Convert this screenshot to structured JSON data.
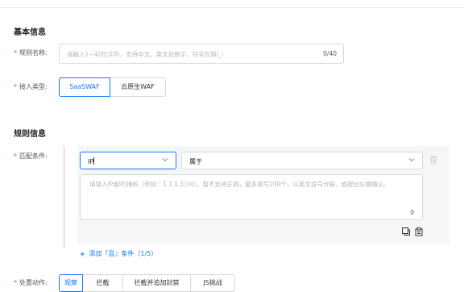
{
  "basic_info": {
    "title": "基本信息",
    "rule_name": {
      "label": "规则名称:",
      "placeholder": "请输入1~40位字符，支持中文、英文及数字，符号仅限/_-",
      "counter": "0/40"
    },
    "access_type": {
      "label": "接入类型:",
      "options": [
        "SaaSWAF",
        "云原生WAF"
      ],
      "selected": "SaaSWAF"
    }
  },
  "rule_info": {
    "title": "规则信息",
    "match_condition": {
      "label": "匹配条件:",
      "field_select": "IP",
      "operator_select": "属于",
      "textarea_placeholder": "请填入IP或IP/掩码（例如：1.1.1.1/24），暂不支持正则，最多填写200个，以英文逗号分隔，或按回车键确认。",
      "textarea_counter": "0",
      "add_condition": "添加『且』条件（1/5）"
    },
    "action": {
      "label": "处置动作:",
      "options": [
        "观察",
        "拦截",
        "拦截并追加封禁",
        "JS挑战"
      ],
      "selected": "观察"
    }
  },
  "icons": [
    "chevron-down-icon",
    "trash-icon",
    "copy-icon",
    "paste-icon",
    "plus-icon"
  ],
  "colors": {
    "primary": "#1677ff",
    "required": "#e8474b",
    "panel_bg": "#f5f6f8",
    "border": "#d9d9d9"
  }
}
